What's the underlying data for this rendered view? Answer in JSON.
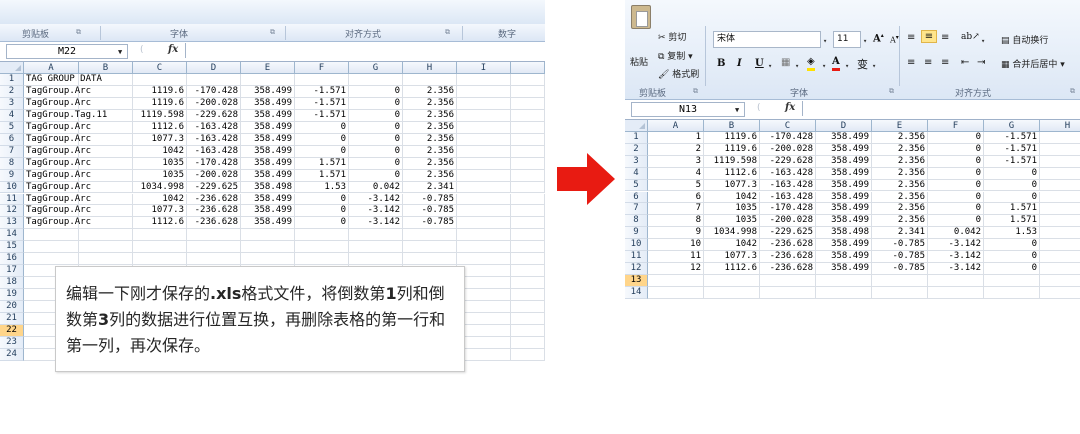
{
  "left": {
    "ribbon": {
      "groups": [
        "剪贴板",
        "字体",
        "对齐方式",
        "数字"
      ]
    },
    "name_box": "M22",
    "fx_label": "fx",
    "columns": [
      "A",
      "B",
      "C",
      "D",
      "E",
      "F",
      "G",
      "H",
      "I"
    ],
    "selected_row": 22,
    "rows": [
      {
        "r": "1",
        "a": "TAG GROUP DATA",
        "c": "",
        "d": "",
        "e": "",
        "f": "",
        "g": "",
        "h": ""
      },
      {
        "r": "2",
        "a": "TagGroup.Arc",
        "c": "1119.6",
        "d": "-170.428",
        "e": "358.499",
        "f": "-1.571",
        "g": "0",
        "h": "2.356"
      },
      {
        "r": "3",
        "a": "TagGroup.Arc",
        "c": "1119.6",
        "d": "-200.028",
        "e": "358.499",
        "f": "-1.571",
        "g": "0",
        "h": "2.356"
      },
      {
        "r": "4",
        "a": "TagGroup.Tag.11",
        "c": "1119.598",
        "d": "-229.628",
        "e": "358.499",
        "f": "-1.571",
        "g": "0",
        "h": "2.356"
      },
      {
        "r": "5",
        "a": "TagGroup.Arc",
        "c": "1112.6",
        "d": "-163.428",
        "e": "358.499",
        "f": "0",
        "g": "0",
        "h": "2.356"
      },
      {
        "r": "6",
        "a": "TagGroup.Arc",
        "c": "1077.3",
        "d": "-163.428",
        "e": "358.499",
        "f": "0",
        "g": "0",
        "h": "2.356"
      },
      {
        "r": "7",
        "a": "TagGroup.Arc",
        "c": "1042",
        "d": "-163.428",
        "e": "358.499",
        "f": "0",
        "g": "0",
        "h": "2.356"
      },
      {
        "r": "8",
        "a": "TagGroup.Arc",
        "c": "1035",
        "d": "-170.428",
        "e": "358.499",
        "f": "1.571",
        "g": "0",
        "h": "2.356"
      },
      {
        "r": "9",
        "a": "TagGroup.Arc",
        "c": "1035",
        "d": "-200.028",
        "e": "358.499",
        "f": "1.571",
        "g": "0",
        "h": "2.356"
      },
      {
        "r": "10",
        "a": "TagGroup.Arc",
        "c": "1034.998",
        "d": "-229.625",
        "e": "358.498",
        "f": "1.53",
        "g": "0.042",
        "h": "2.341"
      },
      {
        "r": "11",
        "a": "TagGroup.Arc",
        "c": "1042",
        "d": "-236.628",
        "e": "358.499",
        "f": "0",
        "g": "-3.142",
        "h": "-0.785"
      },
      {
        "r": "12",
        "a": "TagGroup.Arc",
        "c": "1077.3",
        "d": "-236.628",
        "e": "358.499",
        "f": "0",
        "g": "-3.142",
        "h": "-0.785"
      },
      {
        "r": "13",
        "a": "TagGroup.Arc",
        "c": "1112.6",
        "d": "-236.628",
        "e": "358.499",
        "f": "0",
        "g": "-3.142",
        "h": "-0.785"
      },
      {
        "r": "14"
      },
      {
        "r": "15"
      },
      {
        "r": "16"
      },
      {
        "r": "17"
      },
      {
        "r": "18"
      },
      {
        "r": "19"
      },
      {
        "r": "20"
      },
      {
        "r": "21"
      },
      {
        "r": "22"
      },
      {
        "r": "23"
      },
      {
        "r": "24"
      }
    ],
    "note": {
      "seg1": "编辑一下刚才保存的",
      "seg2": ".xls",
      "seg3": "格式文件，将倒数第",
      "seg4": "1",
      "seg5": "列和倒数第",
      "seg6": "3",
      "seg7": "列的数据进行位置互换，再删除表格的第一行和第一列，再次保存。"
    }
  },
  "right": {
    "ribbon": {
      "paste_label": "粘贴",
      "cut_label": "剪切",
      "copy_label": "复制",
      "format_painter_label": "格式刷",
      "font_name": "宋体",
      "font_size": "11",
      "bold": "B",
      "italic": "I",
      "underline": "U",
      "wrap_text_label": "自动换行",
      "merge_center_label": "合并后居中",
      "groups": [
        "剪贴板",
        "字体",
        "对齐方式"
      ]
    },
    "name_box": "N13",
    "fx_label": "fx",
    "columns": [
      "A",
      "B",
      "C",
      "D",
      "E",
      "F",
      "G",
      "H"
    ],
    "selected_row": 13,
    "rows": [
      {
        "r": "1",
        "a": "1",
        "b": "1119.6",
        "c": "-170.428",
        "d": "358.499",
        "e": "2.356",
        "f": "0",
        "g": "-1.571"
      },
      {
        "r": "2",
        "a": "2",
        "b": "1119.6",
        "c": "-200.028",
        "d": "358.499",
        "e": "2.356",
        "f": "0",
        "g": "-1.571"
      },
      {
        "r": "3",
        "a": "3",
        "b": "1119.598",
        "c": "-229.628",
        "d": "358.499",
        "e": "2.356",
        "f": "0",
        "g": "-1.571"
      },
      {
        "r": "4",
        "a": "4",
        "b": "1112.6",
        "c": "-163.428",
        "d": "358.499",
        "e": "2.356",
        "f": "0",
        "g": "0"
      },
      {
        "r": "5",
        "a": "5",
        "b": "1077.3",
        "c": "-163.428",
        "d": "358.499",
        "e": "2.356",
        "f": "0",
        "g": "0"
      },
      {
        "r": "6",
        "a": "6",
        "b": "1042",
        "c": "-163.428",
        "d": "358.499",
        "e": "2.356",
        "f": "0",
        "g": "0"
      },
      {
        "r": "7",
        "a": "7",
        "b": "1035",
        "c": "-170.428",
        "d": "358.499",
        "e": "2.356",
        "f": "0",
        "g": "1.571"
      },
      {
        "r": "8",
        "a": "8",
        "b": "1035",
        "c": "-200.028",
        "d": "358.499",
        "e": "2.356",
        "f": "0",
        "g": "1.571"
      },
      {
        "r": "9",
        "a": "9",
        "b": "1034.998",
        "c": "-229.625",
        "d": "358.498",
        "e": "2.341",
        "f": "0.042",
        "g": "1.53"
      },
      {
        "r": "10",
        "a": "10",
        "b": "1042",
        "c": "-236.628",
        "d": "358.499",
        "e": "-0.785",
        "f": "-3.142",
        "g": "0"
      },
      {
        "r": "11",
        "a": "11",
        "b": "1077.3",
        "c": "-236.628",
        "d": "358.499",
        "e": "-0.785",
        "f": "-3.142",
        "g": "0"
      },
      {
        "r": "12",
        "a": "12",
        "b": "1112.6",
        "c": "-236.628",
        "d": "358.499",
        "e": "-0.785",
        "f": "-3.142",
        "g": "0"
      },
      {
        "r": "13"
      },
      {
        "r": "14"
      }
    ]
  },
  "colors": {
    "arrow": "#e81b12",
    "selection_header": "#ffd58a",
    "ribbon_bg": "#dce7f5"
  }
}
